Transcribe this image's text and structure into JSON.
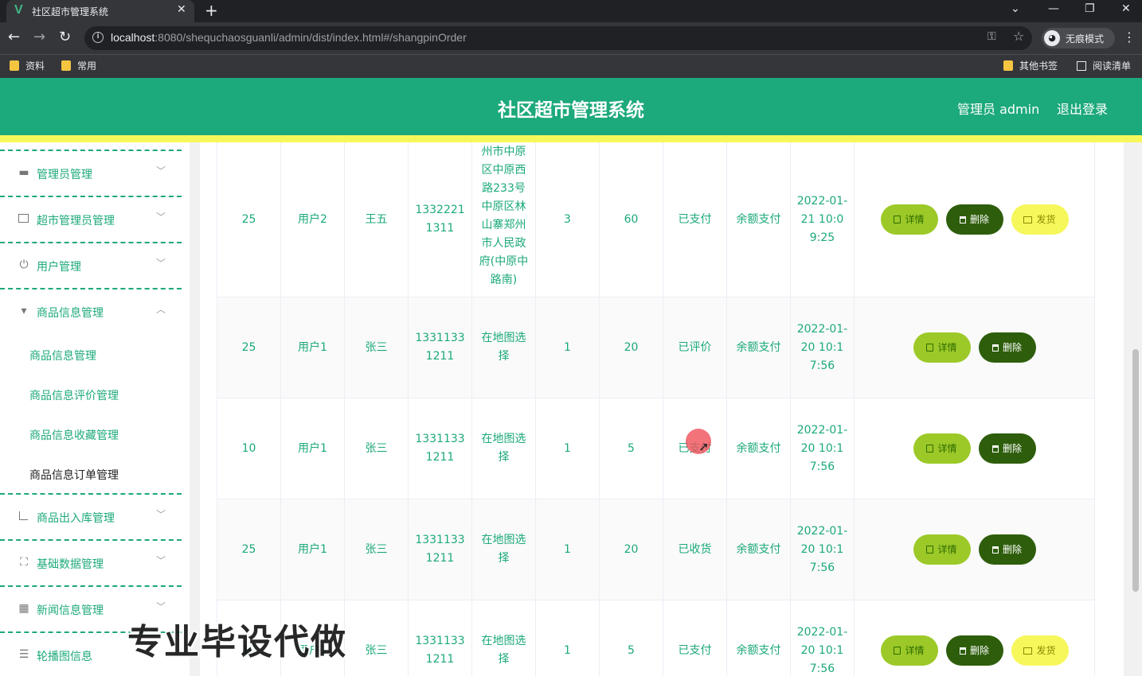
{
  "browser": {
    "tab_title": "社区超市管理系统",
    "tab_logo": "V",
    "url_host": "localhost",
    "url_rest": ":8080/shequchaosguanli/admin/dist/index.html#/shangpinOrder",
    "incognito_label": "无痕模式",
    "bookmarks": [
      "资料",
      "常用"
    ],
    "bookmarks_right": [
      "其他书签",
      "阅读清单"
    ]
  },
  "header": {
    "title": "社区超市管理系统",
    "user": "管理员 admin",
    "logout": "退出登录"
  },
  "sidebar": {
    "items": [
      {
        "label": "管理员管理",
        "icon": "monitor-icon"
      },
      {
        "label": "超市管理员管理",
        "icon": "id-card-icon"
      },
      {
        "label": "用户管理",
        "icon": "power-icon"
      },
      {
        "label": "商品信息管理",
        "icon": "tag-icon"
      }
    ],
    "sub_items": [
      "商品信息管理",
      "商品信息评价管理",
      "商品信息收藏管理",
      "商品信息订单管理"
    ],
    "items_after": [
      {
        "label": "商品出入库管理",
        "icon": "crop-icon"
      },
      {
        "label": "基础数据管理",
        "icon": "fullscreen-icon"
      },
      {
        "label": "新闻信息管理",
        "icon": "grid-icon"
      },
      {
        "label": "轮播图信息",
        "icon": "list-icon"
      }
    ]
  },
  "table": {
    "rows": [
      {
        "c1": "25",
        "c2": "用户2",
        "c3": "王五",
        "c4": "13322211311",
        "c5": "州市中原区中原西路233号中原区林山寨郑州市人民政府(中原中路南)",
        "c6": "3",
        "c7": "60",
        "c8": "已支付",
        "c9": "余额支付",
        "c10": "2022-01-21 10:09:25"
      },
      {
        "c1": "25",
        "c2": "用户1",
        "c3": "张三",
        "c4": "13311331211",
        "c5": "在地图选择",
        "c6": "1",
        "c7": "20",
        "c8": "已评价",
        "c9": "余额支付",
        "c10": "2022-01-20 10:17:56"
      },
      {
        "c1": "10",
        "c2": "用户1",
        "c3": "张三",
        "c4": "13311331211",
        "c5": "在地图选择",
        "c6": "1",
        "c7": "5",
        "c8": "已支付",
        "c9": "余额支付",
        "c10": "2022-01-20 10:17:56"
      },
      {
        "c1": "25",
        "c2": "用户1",
        "c3": "张三",
        "c4": "13311331211",
        "c5": "在地图选择",
        "c6": "1",
        "c7": "20",
        "c8": "已收货",
        "c9": "余额支付",
        "c10": "2022-01-20 10:17:56"
      },
      {
        "c1": "10",
        "c2": "用户1",
        "c3": "张三",
        "c4": "13311331211",
        "c5": "在地图选择",
        "c6": "1",
        "c7": "5",
        "c8": "已支付",
        "c9": "余额支付",
        "c10": "2022-01-20 10:17:56"
      }
    ],
    "actions": {
      "detail": "详情",
      "delete": "删除",
      "ship": "发货"
    }
  },
  "watermark": "专业毕设代做",
  "colors": {
    "primary": "#1ca97b",
    "accent_yellow": "#f6f75b",
    "btn_detail": "#9cc928",
    "btn_delete": "#2e5e0c"
  }
}
